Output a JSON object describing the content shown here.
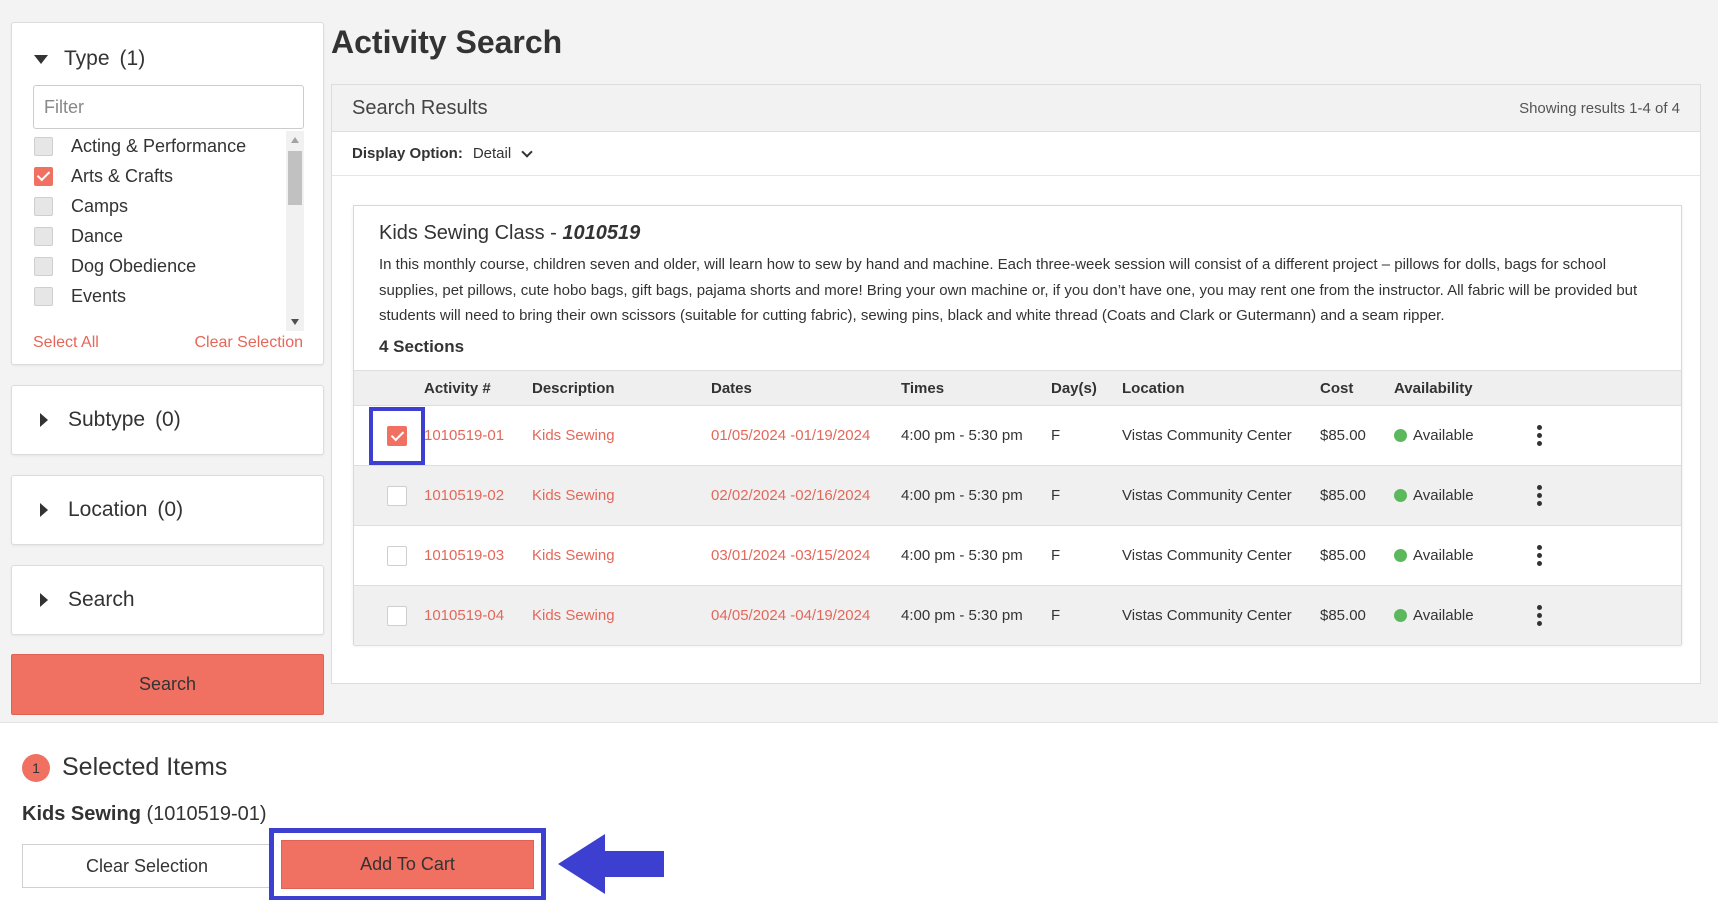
{
  "sidebar": {
    "type_filter": {
      "title": "Type",
      "count": "(1)",
      "filter_placeholder": "Filter",
      "items": [
        {
          "label": "Acting & Performance",
          "checked": false
        },
        {
          "label": "Arts & Crafts",
          "checked": true
        },
        {
          "label": "Camps",
          "checked": false
        },
        {
          "label": "Dance",
          "checked": false
        },
        {
          "label": "Dog Obedience",
          "checked": false
        },
        {
          "label": "Events",
          "checked": false
        }
      ],
      "select_all": "Select All",
      "clear_selection": "Clear Selection"
    },
    "subtype": {
      "title": "Subtype",
      "count": "(0)"
    },
    "location": {
      "title": "Location",
      "count": "(0)"
    },
    "search_section": {
      "title": "Search"
    },
    "search_button": "Search"
  },
  "main": {
    "page_title": "Activity Search",
    "results_title": "Search Results",
    "showing": "Showing results 1-4 of 4",
    "display_option_label": "Display Option:",
    "display_option_value": "Detail",
    "activity": {
      "name": "Kids Sewing Class - ",
      "number": "1010519",
      "description": "In this monthly course, children seven and older, will learn how to sew by hand and machine. Each three-week session will consist of a different project – pillows for dolls, bags for school supplies, pet pillows, cute hobo bags, gift bags, pajama shorts and more! Bring your own machine or, if you don’t have one, you may rent one from the instructor. All fabric will be provided but students will need to bring their own scissors (suitable for cutting fabric), sewing pins, black and white thread (Coats and Clark or Gutermann) and a seam ripper.",
      "sections_label": "4 Sections",
      "columns": [
        "Activity #",
        "Description",
        "Dates",
        "Times",
        "Day(s)",
        "Location",
        "Cost",
        "Availability"
      ],
      "rows": [
        {
          "activity": "1010519-01",
          "description": "Kids Sewing",
          "dates": "01/05/2024 -01/19/2024",
          "times": "4:00 pm - 5:30 pm",
          "days": "F",
          "location": "Vistas Community Center",
          "cost": "$85.00",
          "availability": "Available",
          "checked": true
        },
        {
          "activity": "1010519-02",
          "description": "Kids Sewing",
          "dates": "02/02/2024 -02/16/2024",
          "times": "4:00 pm - 5:30 pm",
          "days": "F",
          "location": "Vistas Community Center",
          "cost": "$85.00",
          "availability": "Available",
          "checked": false
        },
        {
          "activity": "1010519-03",
          "description": "Kids Sewing",
          "dates": "03/01/2024 -03/15/2024",
          "times": "4:00 pm - 5:30 pm",
          "days": "F",
          "location": "Vistas Community Center",
          "cost": "$85.00",
          "availability": "Available",
          "checked": false
        },
        {
          "activity": "1010519-04",
          "description": "Kids Sewing",
          "dates": "04/05/2024 -04/19/2024",
          "times": "4:00 pm - 5:30 pm",
          "days": "F",
          "location": "Vistas Community Center",
          "cost": "$85.00",
          "availability": "Available",
          "checked": false
        }
      ]
    }
  },
  "selected": {
    "badge": "1",
    "title": "Selected Items",
    "item_name": "Kids Sewing",
    "item_code": " (1010519-01)",
    "clear_button": "Clear Selection",
    "add_to_cart_button": "Add To Cart"
  },
  "colors": {
    "accent": "#f07062",
    "link": "#e5675a",
    "highlight": "#3d3fd1",
    "available": "#5cb85c"
  },
  "icons": [
    "caret-down-icon",
    "caret-right-icon",
    "chevron-down-icon",
    "checkbox-icon",
    "available-dot-icon",
    "more-options-icon",
    "arrow-left-icon"
  ]
}
